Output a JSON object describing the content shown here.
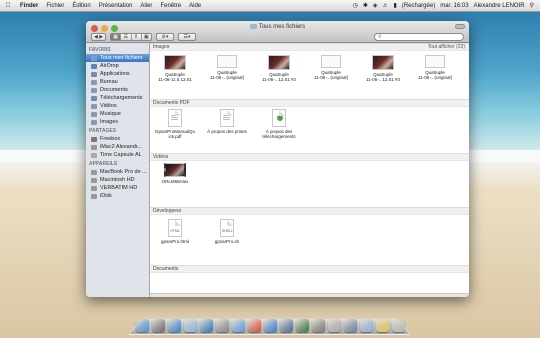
{
  "menubar": {
    "app": "Finder",
    "items": [
      "Fichier",
      "Édition",
      "Présentation",
      "Aller",
      "Fenêtre",
      "Aide"
    ],
    "battery": "(Rechargée)",
    "clock": "mar. 16:03",
    "user": "Alexandre LENOIR"
  },
  "window": {
    "title": "Tous mes fichiers",
    "search_placeholder": ""
  },
  "sidebar": {
    "favoris_header": "FAVORIS",
    "favoris": [
      {
        "label": "Tous mes fichiers",
        "icon": "all-files-icon",
        "color": "#7d9ccc"
      },
      {
        "label": "AirDrop",
        "icon": "airdrop-icon",
        "color": "#5d86b8"
      },
      {
        "label": "Applications",
        "icon": "applications-icon",
        "color": "#7c8aa0"
      },
      {
        "label": "Bureau",
        "icon": "desktop-icon",
        "color": "#8a98ad"
      },
      {
        "label": "Documents",
        "icon": "documents-icon",
        "color": "#8a98ad"
      },
      {
        "label": "Téléchargements",
        "icon": "downloads-icon",
        "color": "#6f8fb9"
      },
      {
        "label": "Vidéos",
        "icon": "movies-icon",
        "color": "#8a98ad"
      },
      {
        "label": "Musique",
        "icon": "music-icon",
        "color": "#8a98ad"
      },
      {
        "label": "Images",
        "icon": "pictures-icon",
        "color": "#8a98ad"
      }
    ],
    "partages_header": "PARTAGES",
    "partages": [
      {
        "label": "Freebox",
        "icon": "network-icon",
        "color": "#777"
      },
      {
        "label": "iMac2 Alexandr...",
        "icon": "imac-icon",
        "color": "#999"
      },
      {
        "label": "Time Capsule AL",
        "icon": "time-capsule-icon",
        "color": "#aaa"
      }
    ],
    "appareils_header": "APPAREILS",
    "appareils": [
      {
        "label": "MacBook Pro de ...",
        "icon": "laptop-icon",
        "color": "#999"
      },
      {
        "label": "Macintosh HD",
        "icon": "hard-drive-icon",
        "color": "#999"
      },
      {
        "label": "VERBATIM HD",
        "icon": "external-drive-icon",
        "color": "#999"
      },
      {
        "label": "iDisk",
        "icon": "idisk-icon",
        "color": "#999"
      }
    ]
  },
  "sections": {
    "images": {
      "header": "Images",
      "show_all": "Tout afficher (23)",
      "items": [
        {
          "label": "Quatruple\n11-06-11 à 12.01",
          "kind": "photo"
        },
        {
          "label": "Quatruple\n11-06-...(original)",
          "kind": "blank"
        },
        {
          "label": "Quatruple\n11-06-...12.01 #2",
          "kind": "photo"
        },
        {
          "label": "Quatruple\n11-06-...(original)",
          "kind": "blank"
        },
        {
          "label": "Quatruple\n11-06-...12.01 #3",
          "kind": "photo"
        },
        {
          "label": "Quatruple\n11-06-...(original)",
          "kind": "blank"
        }
      ]
    },
    "pdf": {
      "header": "Documents PDF",
      "items": [
        {
          "label": "GpsarProManualQu\nick.pdf",
          "badge": ""
        },
        {
          "label": "À propos des prises",
          "badge": ""
        },
        {
          "label": "À propos des\ntéléchargements",
          "badge": ""
        }
      ]
    },
    "videos": {
      "header": "Vidéos",
      "items": [
        {
          "label": "ORLM68Alex"
        }
      ]
    },
    "dev": {
      "header": "Développeur",
      "items": [
        {
          "label": "gpsarPro.html",
          "badge": "HTML"
        },
        {
          "label": "gpsarPro.sh",
          "badge": "SHELL"
        }
      ]
    },
    "docs": {
      "header": "Documents"
    }
  },
  "dock": {
    "icons": [
      {
        "name": "finder-icon",
        "color": "#4f8fd8"
      },
      {
        "name": "launchpad-icon",
        "color": "#6c6c7a"
      },
      {
        "name": "safari-icon",
        "color": "#3b86d0"
      },
      {
        "name": "mail-icon",
        "color": "#8fb7e0"
      },
      {
        "name": "app-store-icon",
        "color": "#2f7bc2"
      },
      {
        "name": "system-preferences-icon",
        "color": "#8a8a8a"
      },
      {
        "name": "itunes-icon",
        "color": "#5aa0e0"
      },
      {
        "name": "ical-icon",
        "color": "#e24c3c"
      },
      {
        "name": "itunes-icon",
        "color": "#3a7fd4"
      },
      {
        "name": "iphoto-icon",
        "color": "#4b6b9c"
      },
      {
        "name": "time-machine-icon",
        "color": "#3f7a3f"
      },
      {
        "name": "utility-icon",
        "color": "#7a7a7a"
      },
      {
        "name": "preview-icon",
        "color": "#a9a9a9"
      },
      {
        "name": "downloads-stack-icon",
        "color": "#6b7da0"
      },
      {
        "name": "folder-stack-icon",
        "color": "#8fb0d6"
      },
      {
        "name": "notes-icon",
        "color": "#e0c84f"
      },
      {
        "name": "trash-icon",
        "color": "#b6b6b6"
      }
    ]
  }
}
